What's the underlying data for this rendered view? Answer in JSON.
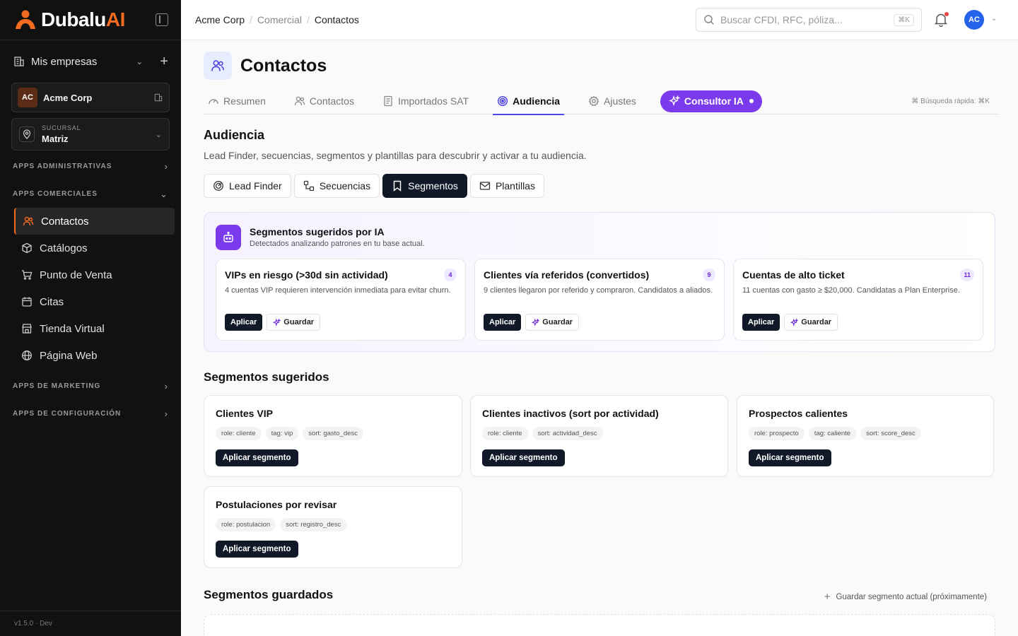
{
  "sidebar": {
    "logo_text": "Dubalu",
    "logo_ai": "AI",
    "companies_label": "Mis empresas",
    "company": {
      "initials": "AC",
      "name": "Acme Corp"
    },
    "branch": {
      "label": "SUCURSAL",
      "value": "Matriz"
    },
    "sections": {
      "admin": "APPS ADMINISTRATIVAS",
      "commercial": "APPS COMERCIALES",
      "marketing": "APPS DE MARKETING",
      "config": "APPS DE CONFIGURACIÓN"
    },
    "items": [
      {
        "label": "Contactos",
        "icon": "users-icon",
        "active": true
      },
      {
        "label": "Catálogos",
        "icon": "box-icon"
      },
      {
        "label": "Punto de Venta",
        "icon": "cart-icon"
      },
      {
        "label": "Citas",
        "icon": "calendar-icon"
      },
      {
        "label": "Tienda Virtual",
        "icon": "store-icon"
      },
      {
        "label": "Página Web",
        "icon": "globe-icon"
      }
    ],
    "version": "v1.5.0 · Dev"
  },
  "topbar": {
    "breadcrumb": [
      "Acme Corp",
      "Comercial",
      "Contactos"
    ],
    "search_placeholder": "Buscar CFDI, RFC, póliza...",
    "search_shortcut": "⌘K",
    "user_initials": "AC"
  },
  "page": {
    "title": "Contactos",
    "tabs": [
      {
        "label": "Resumen",
        "icon": "gauge-icon"
      },
      {
        "label": "Contactos",
        "icon": "users-icon"
      },
      {
        "label": "Importados SAT",
        "icon": "file-icon"
      },
      {
        "label": "Audiencia",
        "icon": "target-icon",
        "active": true
      },
      {
        "label": "Ajustes",
        "icon": "gear-icon"
      }
    ],
    "ia_button": "Consultor IA",
    "quick_search": "⌘ Búsqueda rápida:  ⌘K"
  },
  "audience": {
    "title": "Audiencia",
    "description": "Lead Finder, secuencias, segmentos y plantillas para descubrir y activar a tu audiencia.",
    "subtabs": [
      {
        "label": "Lead Finder",
        "icon": "radar-icon"
      },
      {
        "label": "Secuencias",
        "icon": "workflow-icon"
      },
      {
        "label": "Segmentos",
        "icon": "bookmark-icon",
        "active": true
      },
      {
        "label": "Plantillas",
        "icon": "mail-icon"
      }
    ]
  },
  "ai_segments": {
    "title": "Segmentos sugeridos por IA",
    "subtitle": "Detectados analizando patrones en tu base actual.",
    "apply_label": "Aplicar",
    "save_label": "Guardar",
    "cards": [
      {
        "title": "VIPs en riesgo (>30d sin actividad)",
        "count": "4",
        "description": "4 cuentas VIP requieren intervención inmediata para evitar churn."
      },
      {
        "title": "Clientes vía referidos (convertidos)",
        "count": "9",
        "description": "9 clientes llegaron por referido y compraron. Candidatos a aliados."
      },
      {
        "title": "Cuentas de alto ticket",
        "count": "11",
        "description": "11 cuentas con gasto ≥ $20,000. Candidatas a Plan Enterprise."
      }
    ]
  },
  "suggested": {
    "title": "Segmentos sugeridos",
    "apply_label": "Aplicar segmento",
    "cards": [
      {
        "title": "Clientes VIP",
        "chips": [
          "role: cliente",
          "tag: vip",
          "sort: gasto_desc"
        ]
      },
      {
        "title": "Clientes inactivos (sort por actividad)",
        "chips": [
          "role: cliente",
          "sort: actividad_desc"
        ]
      },
      {
        "title": "Prospectos calientes",
        "chips": [
          "role: prospecto",
          "tag: caliente",
          "sort: score_desc"
        ]
      },
      {
        "title": "Postulaciones por revisar",
        "chips": [
          "role: postulacion",
          "sort: registro_desc"
        ]
      }
    ]
  },
  "saved": {
    "title": "Segmentos guardados",
    "action": "Guardar segmento actual (próximamente)"
  },
  "colors": {
    "brand_orange": "#f26b21",
    "accent_purple": "#7c3aed",
    "accent_indigo": "#4f46e5",
    "dark": "#111827"
  }
}
